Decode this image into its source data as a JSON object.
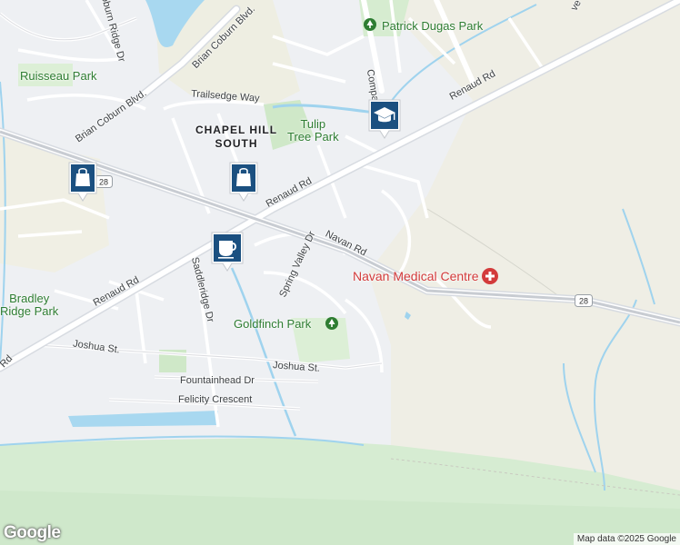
{
  "map": {
    "neighbourhood": "CHAPEL HILL SOUTH",
    "streets": {
      "renaud_upper": "Renaud Rd",
      "renaud_mid": "Renaud Rd",
      "renaud_lower": "Renaud Rd",
      "navan": "Navan Rd",
      "brian_coburn_1": "Brian Coburn Blvd.",
      "brian_coburn_2": "Brian Coburn Blvd.",
      "coburn_ridge": "Coburn Ridge Dr",
      "trailsedge": "Trailsedge Way",
      "spring_valley": "Spring Valley Dr",
      "saddleridge": "Saddleridge Dr",
      "joshua_1": "Joshua St.",
      "joshua_2": "Joshua St.",
      "fountainhead": "Fountainhead Dr",
      "felicity": "Felicity Crescent",
      "compass_partial": "Compa",
      "edge_partial": "ve"
    },
    "parks": {
      "patrick_dugas": "Patrick Dugas Park",
      "ruisseau": "Ruisseau Park",
      "tulip_tree_line1": "Tulip",
      "tulip_tree_line2": "Tree Park",
      "bradley_ridge_line1": "Bradley",
      "bradley_ridge_line2": "Ridge Park",
      "goldfinch": "Goldfinch Park"
    },
    "poi": {
      "medical": "Navan Medical Centre"
    },
    "route_badges": [
      "28",
      "28"
    ],
    "icons": [
      "shopping-bag-icon",
      "shopping-bag-icon",
      "coffee-cup-icon",
      "graduation-cap-icon",
      "park-tree-icon",
      "medical-cross-icon"
    ],
    "colors": {
      "pin": "#1a73e8",
      "park": "#2e7d32",
      "medical": "#d33b3b",
      "water": "#a8d8f0"
    },
    "footer": {
      "logo": "Google",
      "attribution": "Map data ©2025 Google"
    }
  }
}
